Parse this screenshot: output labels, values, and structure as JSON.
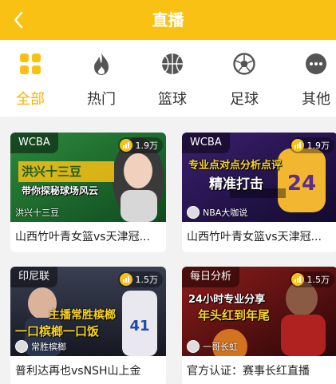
{
  "header": {
    "title": "直播",
    "back_icon": "back-arrow-icon"
  },
  "colors": {
    "brand": "#f9c113",
    "active_tab": "#f4b400"
  },
  "categories": [
    {
      "label": "全部",
      "icon": "grid-icon",
      "active": true
    },
    {
      "label": "热门",
      "icon": "flame-icon",
      "active": false
    },
    {
      "label": "篮球",
      "icon": "basketball-icon",
      "active": false
    },
    {
      "label": "足球",
      "icon": "soccer-ball-icon",
      "active": false
    },
    {
      "label": "其他",
      "icon": "more-icon",
      "active": false
    }
  ],
  "cards": [
    {
      "league": "WCBA",
      "viewers": "1.9万",
      "overlay": [
        "洪兴十三豆",
        "带你探秘球场风云"
      ],
      "anchor": "洪兴十三豆",
      "title": "山西竹叶青女篮vs天津冠..."
    },
    {
      "league": "WCBA",
      "viewers": "1.9万",
      "overlay": [
        "专业点对点分析点评",
        "精准打击"
      ],
      "anchor": "NBA大咖说",
      "title": "山西竹叶青女篮vs天津冠..."
    },
    {
      "league": "印尼联",
      "viewers": "1.5万",
      "overlay": [
        "主播常胜槟榔",
        "一口槟榔一口饭"
      ],
      "anchor": "常胜槟榔",
      "title": "普利达再也vsNSH山上金"
    },
    {
      "league": "每日分析",
      "viewers": "1.5万",
      "overlay": [
        "24小时专业分享",
        "年头红到年尾"
      ],
      "anchor": "一哥长虹",
      "title": "官方认证：赛事长红直播"
    }
  ]
}
